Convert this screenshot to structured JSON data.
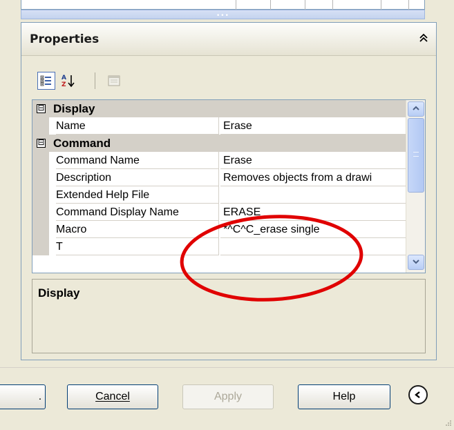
{
  "properties_panel": {
    "title": "Properties",
    "toolbar": {
      "categorized_icon": "categorized-icon",
      "alphabetical_icon": "alphabetical-sort-icon",
      "property_pages_icon": "property-pages-icon"
    },
    "grid": {
      "categories": [
        {
          "label": "Display",
          "toggle": "⊟"
        },
        {
          "label": "Command",
          "toggle": "⊟"
        }
      ],
      "rows": [
        {
          "name": "Name",
          "value": "Erase"
        },
        {
          "name": "Command Name",
          "value": "Erase"
        },
        {
          "name": "Description",
          "value": "Removes objects from a drawi"
        },
        {
          "name": "Extended Help File",
          "value": ""
        },
        {
          "name": "Command Display Name",
          "value": "ERASE"
        },
        {
          "name": "Macro",
          "value": "*^C^C_erase single"
        },
        {
          "name": "T",
          "value": ""
        }
      ]
    },
    "description": {
      "title": "Display"
    }
  },
  "dialog_buttons": {
    "cancel": "Cancel",
    "apply": "Apply",
    "help": "Help",
    "partial_left": "."
  },
  "colors": {
    "annotation": "#e00000",
    "panel_border": "#7f9db9",
    "category_bg": "#d4d0c8"
  }
}
